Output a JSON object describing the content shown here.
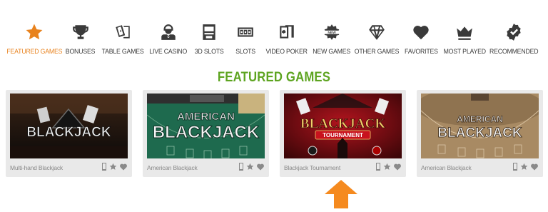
{
  "categories": [
    {
      "label": "FEATURED GAMES",
      "icon": "star-icon",
      "active": true
    },
    {
      "label": "BONUSES",
      "icon": "trophy-icon"
    },
    {
      "label": "TABLE GAMES",
      "icon": "playing-cards-icon"
    },
    {
      "label": "LIVE CASINO",
      "icon": "dealer-icon"
    },
    {
      "label": "3D SLOTS",
      "icon": "slot-machine-icon"
    },
    {
      "label": "SLOTS",
      "icon": "slot-reels-icon"
    },
    {
      "label": "VIDEO POKER",
      "icon": "video-poker-icon"
    },
    {
      "label": "NEW GAMES",
      "icon": "new-badge-icon"
    },
    {
      "label": "OTHER GAMES",
      "icon": "diamond-icon"
    },
    {
      "label": "FAVORITES",
      "icon": "heart-icon"
    },
    {
      "label": "MOST PLAYED",
      "icon": "crown-icon"
    },
    {
      "label": "Recommended",
      "icon": "check-badge-icon"
    }
  ],
  "section_title": "FEATURED GAMES",
  "games": [
    {
      "name": "Multi-hand Blackjack",
      "thumb_line1": "BLACKJACK",
      "thumb_line2": ""
    },
    {
      "name": "American Blackjack",
      "thumb_line1": "AMERICAN",
      "thumb_line2": "BLACKJACK"
    },
    {
      "name": "Blackjack Tournament",
      "thumb_line1": "BLACKJACK",
      "thumb_line2": "TOURNAMENT"
    },
    {
      "name": "American Blackjack",
      "thumb_line1": "AMERICAN",
      "thumb_line2": "BLACKJACK"
    }
  ],
  "colors": {
    "accent_orange": "#e8821d",
    "title_green": "#5da420",
    "icon_dark": "#3a3a3a",
    "card_bg": "#e9e9e9"
  }
}
